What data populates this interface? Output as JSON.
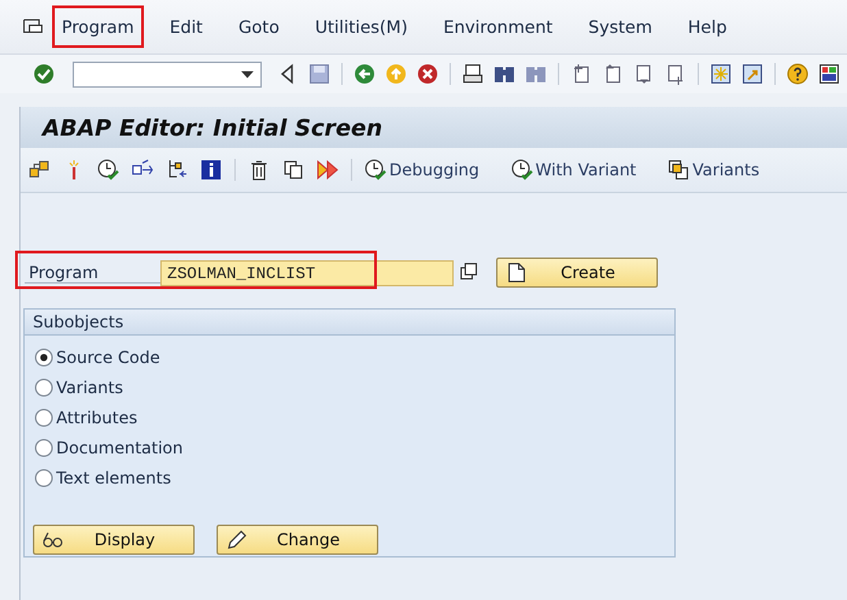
{
  "menu": [
    {
      "label": "Program",
      "highlighted": true
    },
    {
      "label": "Edit",
      "highlighted": false
    },
    {
      "label": "Goto",
      "highlighted": false
    },
    {
      "label": "Utilities(M)",
      "highlighted": false
    },
    {
      "label": "Environment",
      "highlighted": false
    },
    {
      "label": "System",
      "highlighted": false
    },
    {
      "label": "Help",
      "highlighted": false
    }
  ],
  "title": "ABAP Editor: Initial Screen",
  "app_toolbar": [
    {
      "label": "Debugging",
      "kind": "clock"
    },
    {
      "label": "With Variant",
      "kind": "clock"
    },
    {
      "label": "Variants",
      "kind": "stack"
    }
  ],
  "program_field": {
    "label": "Program",
    "value": "ZSOLMAN_INCLIST",
    "highlighted": true
  },
  "create_button": "Create",
  "subobjects": {
    "title": "Subobjects",
    "options": [
      {
        "label": "Source Code",
        "selected": true
      },
      {
        "label": "Variants",
        "selected": false
      },
      {
        "label": "Attributes",
        "selected": false
      },
      {
        "label": "Documentation",
        "selected": false
      },
      {
        "label": "Text elements",
        "selected": false
      }
    ],
    "buttons": [
      {
        "label": "Display",
        "kind": "glasses"
      },
      {
        "label": "Change",
        "kind": "pencil"
      }
    ]
  }
}
